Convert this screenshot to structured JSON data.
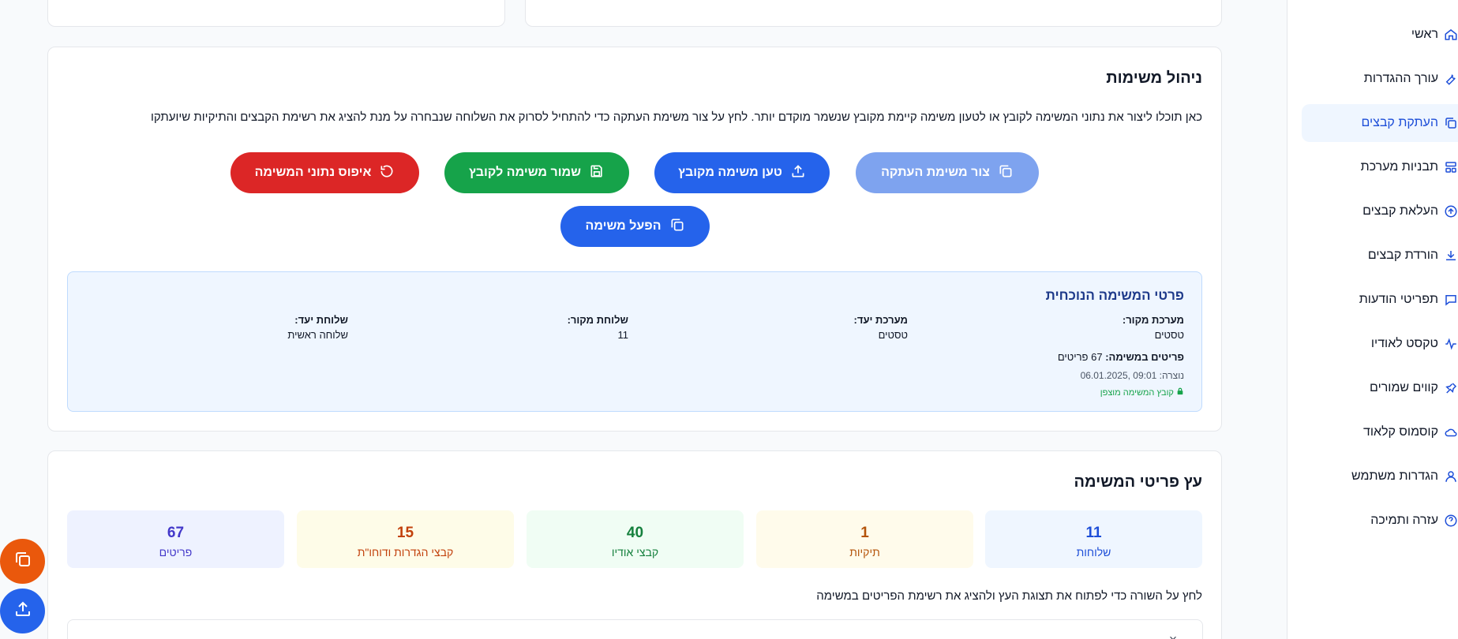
{
  "sidebar": {
    "items": [
      {
        "label": "ראשי",
        "icon": "home-icon"
      },
      {
        "label": "עורך ההגדרות",
        "icon": "wrench-icon"
      },
      {
        "label": "העתקת קבצים",
        "icon": "copy-icon",
        "active": true
      },
      {
        "label": "תבניות מערכת",
        "icon": "template-icon"
      },
      {
        "label": "העלאת קבצים",
        "icon": "upload-circle-icon"
      },
      {
        "label": "הורדת קבצים",
        "icon": "download-icon"
      },
      {
        "label": "תפריטי הודעות",
        "icon": "message-icon"
      },
      {
        "label": "טקסט לאודיו",
        "icon": "audio-wave-icon"
      },
      {
        "label": "קווים שמורים",
        "icon": "pin-icon"
      },
      {
        "label": "קוסמוס קלאוד",
        "icon": "cloud-icon"
      },
      {
        "label": "הגדרות משתמש",
        "icon": "user-icon"
      },
      {
        "label": "עזרה ותמיכה",
        "icon": "help-icon"
      }
    ]
  },
  "task_management": {
    "title": "ניהול משימות",
    "description": "כאן תוכלו ליצור את נתוני המשימה לקובץ או לטעון משימה קיימת מקובץ שנשמר מוקדם יותר. לחץ על צור משימת העתקה כדי להתחיל לסרוק את השלוחה שנבחרה על מנת להציג את רשימת הקבצים והתיקיות שיועתקו",
    "buttons": {
      "create": "צור משימת העתקה",
      "load": "טען משימה מקובץ",
      "save": "שמור משימה לקובץ",
      "reset": "איפוס נתוני המשימה",
      "run": "הפעל משימה"
    }
  },
  "current_task": {
    "title": "פרטי המשימה הנוכחית",
    "source_system_label": "מערכת מקור:",
    "source_system_value": "טסטים",
    "target_system_label": "מערכת יעד:",
    "target_system_value": "טסטים",
    "source_ext_label": "שלוחת מקור:",
    "source_ext_value": "11",
    "target_ext_label": "שלוחת יעד:",
    "target_ext_value": "שלוחה ראשית",
    "items_label": "פריטים במשימה:",
    "items_value": "67 פריטים",
    "created_label": "נוצרה:",
    "created_value": "06.01.2025, 09:01",
    "encrypted_text": "קובץ המשימה מוצפן"
  },
  "tree": {
    "title": "עץ פריטי המשימה",
    "stats": [
      {
        "value": "11",
        "label": "שלוחות",
        "color": "#1d4ed8",
        "bg": "#eff6ff"
      },
      {
        "value": "1",
        "label": "תיקיות",
        "color": "#b45309",
        "bg": "#fffbeb"
      },
      {
        "value": "40",
        "label": "קבצי אודיו",
        "color": "#15803d",
        "bg": "#f0fdf4"
      },
      {
        "value": "15",
        "label": "קבצי הגדרות ודוחו\"ת",
        "color": "#c2410c",
        "bg": "#fefce8"
      },
      {
        "value": "67",
        "label": "פריטים",
        "color": "#4338ca",
        "bg": "#eef2ff"
      }
    ],
    "hint": "לחץ על השורה כדי לפתוח את תצוגת העץ ולהציג את רשימת הפריטים במשימה"
  },
  "colors": {
    "primary": "#2563eb",
    "green": "#16a34a",
    "red": "#dc2626",
    "fab_orange": "#ea580c"
  }
}
